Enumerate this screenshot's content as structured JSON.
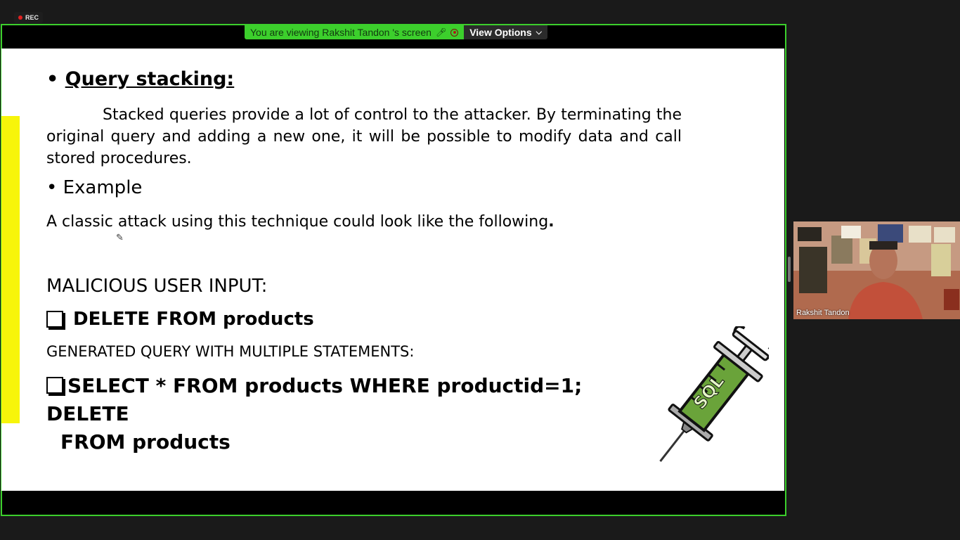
{
  "recording": {
    "label": "REC"
  },
  "share_banner": {
    "message": "You are viewing Rakshit Tandon 's screen",
    "view_options_label": "View Options"
  },
  "slide": {
    "heading": "Query stacking:",
    "paragraph": "Stacked queries provide a lot of control to the attacker. By terminating the original query and adding a new one, it will be possible to modify data and call stored procedures.",
    "example_heading": "Example",
    "example_line": "A classic attack using this technique could look like the following",
    "example_line_end": ".",
    "malicious_label": "MALICIOUS USER INPUT:",
    "malicious_input": "DELETE FROM products",
    "generated_label": "GENERATED QUERY WITH MULTIPLE STATEMENTS:",
    "generated_query_line1": "SELECT * FROM products WHERE productid=1; DELETE",
    "generated_query_line2": "FROM products",
    "syringe_text": "SQL"
  },
  "participant": {
    "name": "Rakshit Tandon"
  },
  "colors": {
    "share_border": "#3ccf2c",
    "highlight_bar": "#f7f50a",
    "syringe_fill": "#6aa33a"
  }
}
